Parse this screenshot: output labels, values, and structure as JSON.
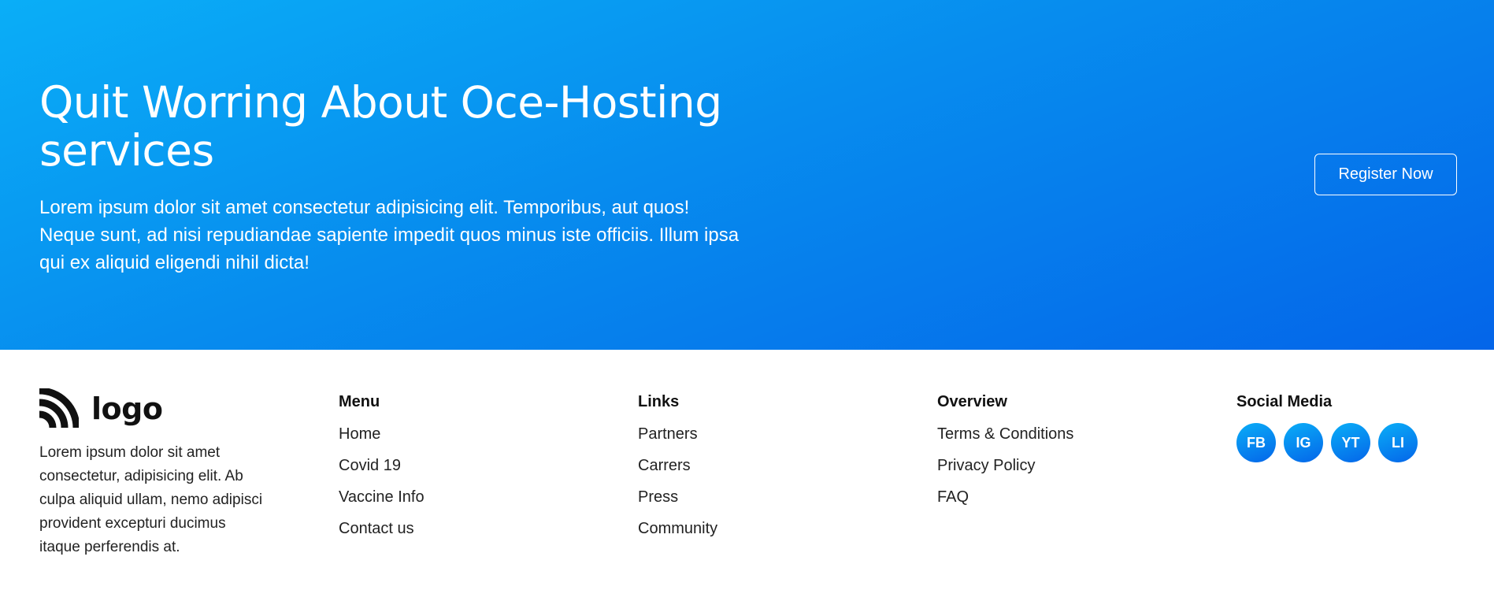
{
  "hero": {
    "title": "Quit Worring About Oce-Hosting services",
    "description": "Lorem ipsum dolor sit amet consectetur adipisicing elit. Temporibus, aut quos! Neque sunt, ad nisi repudiandae sapiente impedit quos minus iste officiis. Illum ipsa qui ex aliquid eligendi nihil dicta!",
    "cta_label": "Register Now"
  },
  "footer": {
    "brand": {
      "logo_text": "logo",
      "logo_icon": "rss-arcs-icon",
      "description": "Lorem ipsum dolor sit amet consectetur, adipisicing elit. Ab culpa aliquid ullam, nemo adipisci provident excepturi ducimus itaque perferendis at."
    },
    "menu": {
      "heading": "Menu",
      "items": [
        "Home",
        "Covid 19",
        "Vaccine Info",
        "Contact us"
      ]
    },
    "links": {
      "heading": "Links",
      "items": [
        "Partners",
        "Carrers",
        "Press",
        "Community"
      ]
    },
    "overview": {
      "heading": "Overview",
      "items": [
        "Terms & Conditions",
        "Privacy Policy",
        "FAQ"
      ]
    },
    "social": {
      "heading": "Social Media",
      "items": [
        "FB",
        "IG",
        "YT",
        "LI"
      ]
    }
  },
  "colors": {
    "hero_gradient_start": "#0aaef7",
    "hero_gradient_end": "#0465e9",
    "text_dark": "#111111",
    "white": "#ffffff"
  }
}
